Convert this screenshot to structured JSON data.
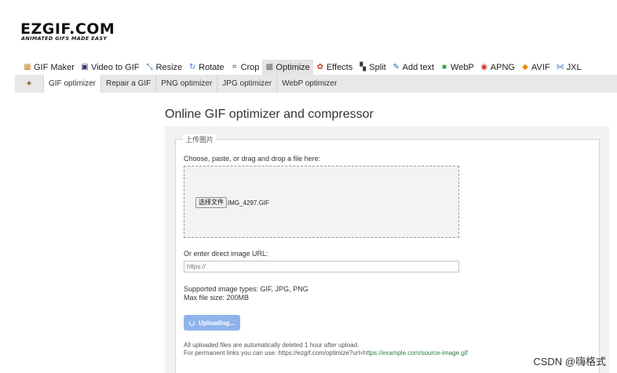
{
  "logo": {
    "main": "EZGIF.COM",
    "sub": "ANIMATED GIFS MADE EASY"
  },
  "main_nav": [
    {
      "label": "GIF Maker",
      "icon": "gif-maker-icon",
      "color": "#c98a2b"
    },
    {
      "label": "Video to GIF",
      "icon": "video-icon",
      "color": "#333366"
    },
    {
      "label": "Resize",
      "icon": "resize-icon",
      "color": "#3366aa"
    },
    {
      "label": "Rotate",
      "icon": "rotate-icon",
      "color": "#3a7bd5"
    },
    {
      "label": "Crop",
      "icon": "crop-icon",
      "color": "#555555"
    },
    {
      "label": "Optimize",
      "icon": "optimize-icon",
      "color": "#6a6a6a",
      "active": true
    },
    {
      "label": "Effects",
      "icon": "effects-icon",
      "color": "#c0392b"
    },
    {
      "label": "Split",
      "icon": "split-icon",
      "color": "#333333"
    },
    {
      "label": "Add text",
      "icon": "add-text-icon",
      "color": "#2b6cb0"
    },
    {
      "label": "WebP",
      "icon": "webp-icon",
      "color": "#43a047"
    },
    {
      "label": "APNG",
      "icon": "apng-icon",
      "color": "#d32f2f"
    },
    {
      "label": "AVIF",
      "icon": "avif-icon",
      "color": "#ef8a00"
    },
    {
      "label": "JXL",
      "icon": "jxl-icon",
      "color": "#5b8fd6"
    }
  ],
  "sub_nav": [
    {
      "label": "GIF optimizer",
      "active": true
    },
    {
      "label": "Repair a GIF"
    },
    {
      "label": "PNG optimizer"
    },
    {
      "label": "JPG optimizer"
    },
    {
      "label": "WebP optimizer"
    }
  ],
  "page_title": "Online GIF optimizer and compressor",
  "upload": {
    "legend": "上传图片",
    "choose_label": "Choose, paste, or drag and drop a file here:",
    "file_button": "选择文件",
    "file_name": "IMG_4297.GIF",
    "url_label": "Or enter direct image URL:",
    "url_placeholder": "https://",
    "supported": "Supported image types: GIF, JPG, PNG",
    "max_size": "Max file size: 200MB",
    "upload_button": "Uploading...",
    "note1": "All uploaded files are automatically deleted 1 hour after upload.",
    "note2_prefix": "For permanent links you can use: https://ezgif.com/optimize?url=",
    "note2_link": "https://example.com/source-image.gif"
  },
  "watermark": "CSDN @嗨格式"
}
